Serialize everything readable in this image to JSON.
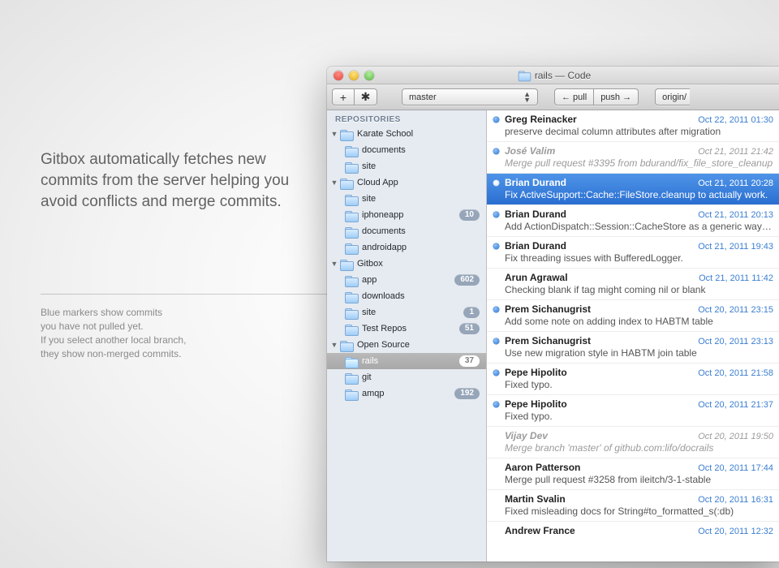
{
  "marketing": {
    "headline": "Gitbox automatically fetches new commits from the server helping you avoid conflicts and merge commits.",
    "sub": "Blue markers show commits\nyou have not pulled yet.\nIf you select another local branch,\nthey show non-merged commits."
  },
  "window": {
    "title": "rails — Code"
  },
  "toolbar": {
    "add_label": "+",
    "settings_label": "✱",
    "branch": "master",
    "pull_label": "← pull",
    "push_label": "push →",
    "remote_label": "origin/"
  },
  "sidebar": {
    "header": "REPOSITORIES",
    "groups": [
      {
        "name": "Karate School",
        "items": [
          {
            "name": "documents",
            "badge": null
          },
          {
            "name": "site",
            "badge": null
          }
        ]
      },
      {
        "name": "Cloud App",
        "items": [
          {
            "name": "site",
            "badge": null
          },
          {
            "name": "iphoneapp",
            "badge": "10"
          },
          {
            "name": "documents",
            "badge": null
          },
          {
            "name": "androidapp",
            "badge": null
          }
        ]
      },
      {
        "name": "Gitbox",
        "items": [
          {
            "name": "app",
            "badge": "602"
          },
          {
            "name": "downloads",
            "badge": null
          },
          {
            "name": "site",
            "badge": "1"
          },
          {
            "name": "Test Repos",
            "badge": "51"
          }
        ]
      },
      {
        "name": "Open Source",
        "items": [
          {
            "name": "rails",
            "badge": "37",
            "selected": true
          },
          {
            "name": "git",
            "badge": null
          },
          {
            "name": "amqp",
            "badge": "192"
          }
        ]
      }
    ]
  },
  "commits": [
    {
      "author": "Greg Reinacker",
      "date": "Oct 22, 2011 01:30",
      "msg": "preserve decimal column attributes after migration",
      "unread": true
    },
    {
      "author": "José Valim",
      "date": "Oct 21, 2011 21:42",
      "msg": "Merge pull request #3395 from bdurand/fix_file_store_cleanup",
      "unread": true,
      "merge": true
    },
    {
      "author": "Brian Durand",
      "date": "Oct 21, 2011 20:28",
      "msg": "Fix ActiveSupport::Cache::FileStore.cleanup to actually work.",
      "unread": true,
      "selected": true
    },
    {
      "author": "Brian Durand",
      "date": "Oct 21, 2011 20:13",
      "msg": "Add ActionDispatch::Session::CacheStore as a generic way…",
      "unread": true
    },
    {
      "author": "Brian Durand",
      "date": "Oct 21, 2011 19:43",
      "msg": "Fix threading issues with BufferedLogger.",
      "unread": true
    },
    {
      "author": "Arun Agrawal",
      "date": "Oct 21, 2011 11:42",
      "msg": "Checking blank if tag might coming nil or blank",
      "unread": false
    },
    {
      "author": "Prem Sichanugrist",
      "date": "Oct 20, 2011 23:15",
      "msg": "Add some note on adding index to HABTM table",
      "unread": true
    },
    {
      "author": "Prem Sichanugrist",
      "date": "Oct 20, 2011 23:13",
      "msg": "Use new migration style in HABTM join table",
      "unread": true
    },
    {
      "author": "Pepe Hipolito",
      "date": "Oct 20, 2011 21:58",
      "msg": "Fixed typo.",
      "unread": true
    },
    {
      "author": "Pepe Hipolito",
      "date": "Oct 20, 2011 21:37",
      "msg": "Fixed typo.",
      "unread": true
    },
    {
      "author": "Vijay Dev",
      "date": "Oct 20, 2011 19:50",
      "msg": "Merge branch 'master' of github.com:lifo/docrails",
      "unread": false,
      "merge": true
    },
    {
      "author": "Aaron Patterson",
      "date": "Oct 20, 2011 17:44",
      "msg": "Merge pull request #3258 from ileitch/3-1-stable",
      "unread": false
    },
    {
      "author": "Martin Svalin",
      "date": "Oct 20, 2011 16:31",
      "msg": "Fixed misleading docs for String#to_formatted_s(:db)",
      "unread": false
    },
    {
      "author": "Andrew France",
      "date": "Oct 20, 2011 12:32",
      "msg": "",
      "unread": false,
      "cutoff": true
    }
  ]
}
